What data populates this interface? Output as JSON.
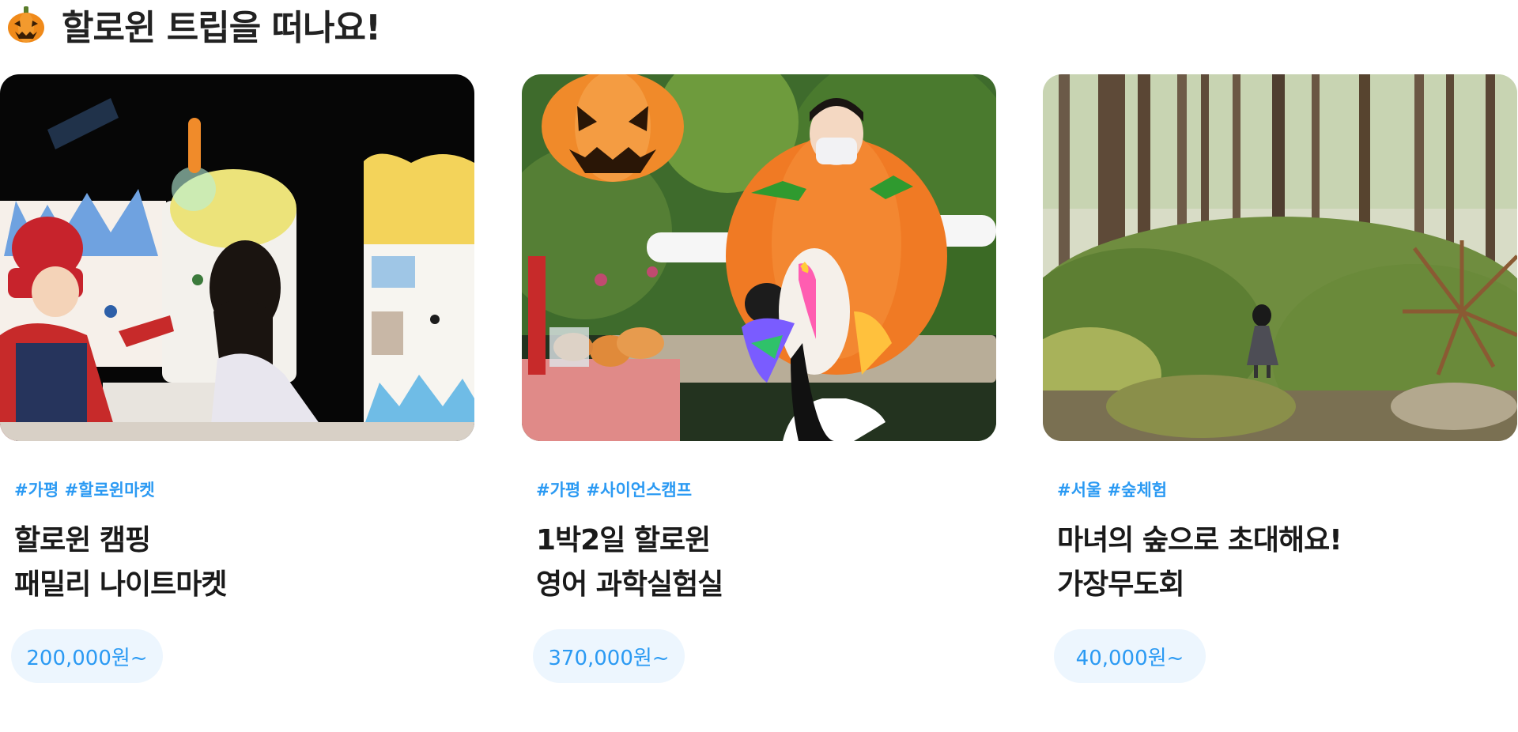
{
  "section": {
    "icon": "jack-o-lantern-icon",
    "title": "할로윈 트립을 떠나요!"
  },
  "colors": {
    "accent": "#2b9af3",
    "badge_bg": "#edf6fe",
    "title": "#1a1a1a"
  },
  "cards": [
    {
      "image": "night-market-photo",
      "tags": "#가평 #할로윈마켓",
      "title_line1": "할로윈 캠핑",
      "title_line2": "패밀리 나이트마켓",
      "price": "200,000원~"
    },
    {
      "image": "pumpkin-costume-photo",
      "tags": "#가평 #사이언스캠프",
      "title_line1": "1박2일 할로윈",
      "title_line2": "영어 과학실험실",
      "price": "370,000원~"
    },
    {
      "image": "forest-photo",
      "tags": "#서울 #숲체험",
      "title_line1": "마녀의 숲으로 초대해요!",
      "title_line2": "가장무도회",
      "price": "40,000원~"
    }
  ]
}
